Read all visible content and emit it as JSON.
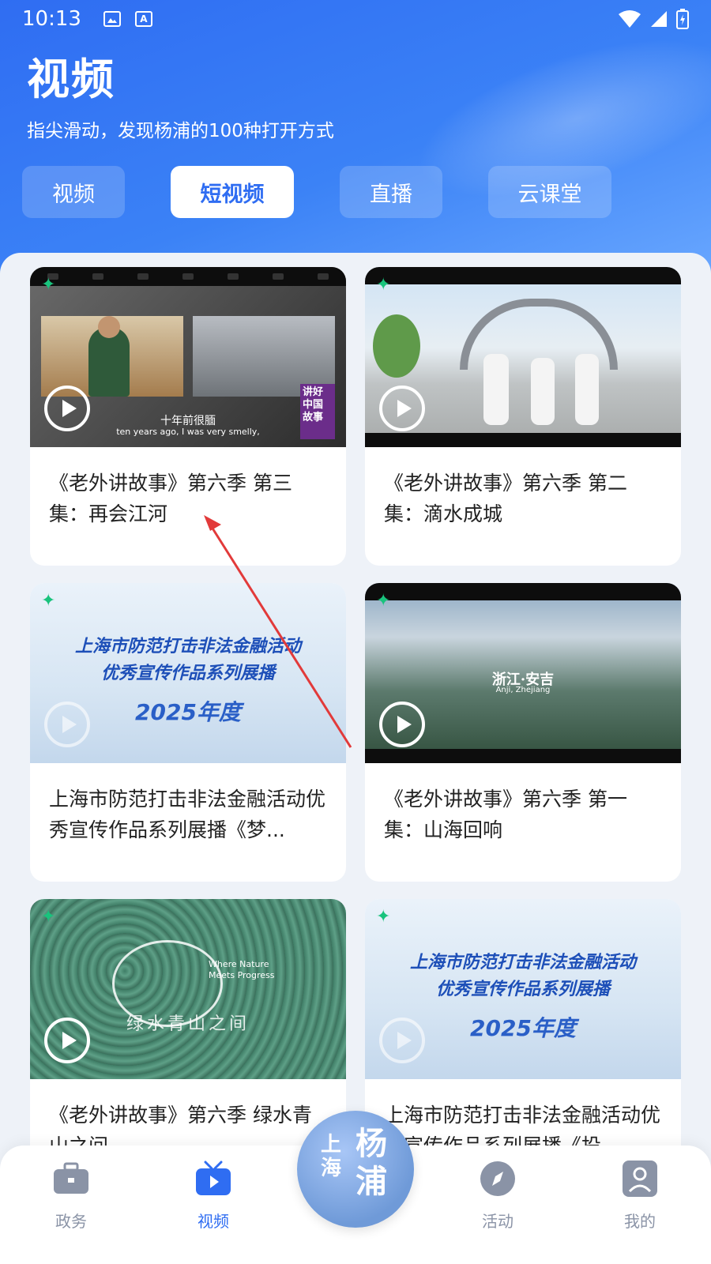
{
  "status_bar": {
    "time": "10:13"
  },
  "header": {
    "title": "视频",
    "subtitle": "指尖滑动，发现杨浦的100种打开方式"
  },
  "tabs": [
    {
      "label": "视频",
      "active": false
    },
    {
      "label": "短视频",
      "active": true
    },
    {
      "label": "直播",
      "active": false
    },
    {
      "label": "云课堂",
      "active": false
    }
  ],
  "cards": [
    {
      "title": "《老外讲故事》第六季 第三集：再会江河",
      "thumb_caption_cn": "十年前很腼",
      "thumb_caption_en": "ten years ago, I was very smelly,",
      "thumb_badge": "讲好中国故事"
    },
    {
      "title": "《老外讲故事》第六季 第二集：滴水成城"
    },
    {
      "title": "上海市防范打击非法金融活动优秀宣传作品系列展播《梦...",
      "thumb_line1": "上海市防范打击非法金融活动",
      "thumb_line2": "优秀宣传作品系列展播",
      "thumb_line3": "2025年度"
    },
    {
      "title": "《老外讲故事》第六季 第一集：山海回响",
      "thumb_place": "浙江·安吉",
      "thumb_place_en": "Anji, Zhejiang"
    },
    {
      "title": "《老外讲故事》第六季 绿水青山之间",
      "thumb_logo_cn": "绿水青山之间",
      "thumb_logo_en": "Where Nature Meets Progress"
    },
    {
      "title": "上海市防范打击非法金融活动优秀宣传作品系列展播《投",
      "thumb_line1": "上海市防范打击非法金融活动",
      "thumb_line2": "优秀宣传作品系列展播",
      "thumb_line3": "2025年度"
    }
  ],
  "bottom_nav": [
    {
      "label": "政务",
      "icon": "briefcase-icon",
      "active": false
    },
    {
      "label": "视频",
      "icon": "tv-icon",
      "active": true
    },
    {
      "label": "活动",
      "icon": "compass-icon",
      "active": false
    },
    {
      "label": "我的",
      "icon": "profile-icon",
      "active": false
    }
  ],
  "center_logo": {
    "line1": "上海",
    "line2": "杨浦"
  },
  "colors": {
    "brand": "#2f6df2",
    "nav_inactive": "#8a93a6",
    "title_text": "#222222"
  }
}
